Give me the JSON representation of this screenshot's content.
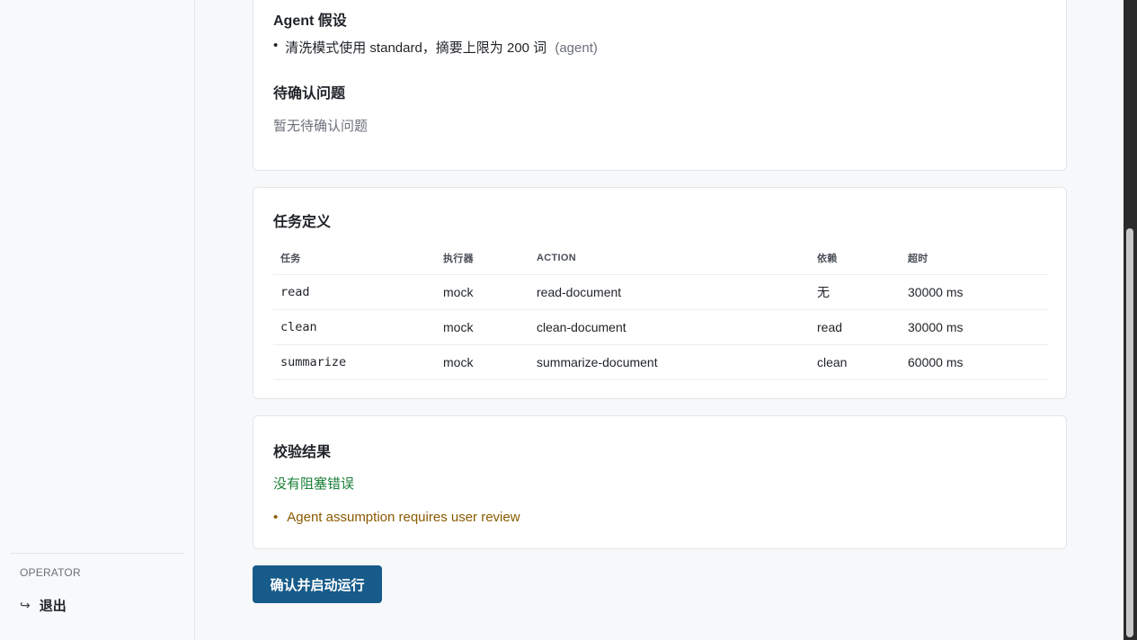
{
  "sidebar": {
    "role_label": "OPERATOR",
    "logout_icon": "↪",
    "logout_label": "退出"
  },
  "assumptions": {
    "title": "Agent 假设",
    "items": [
      {
        "text": "清洗模式使用 standard，摘要上限为 200 词",
        "source": "(agent)"
      }
    ]
  },
  "pending": {
    "title": "待确认问题",
    "empty_text": "暂无待确认问题"
  },
  "tasks": {
    "title": "任务定义",
    "columns": [
      "任务",
      "执行器",
      "ACTION",
      "依赖",
      "超时"
    ],
    "rows": [
      [
        "read",
        "mock",
        "read-document",
        "无",
        "30000 ms"
      ],
      [
        "clean",
        "mock",
        "clean-document",
        "read",
        "30000 ms"
      ],
      [
        "summarize",
        "mock",
        "summarize-document",
        "clean",
        "60000 ms"
      ]
    ]
  },
  "validation": {
    "title": "校验结果",
    "ok_text": "没有阻塞错误",
    "warnings": [
      "Agent assumption requires user review"
    ],
    "ok_color": "#1a7f37",
    "warn_color": "#8a5a00"
  },
  "actions": {
    "confirm_label": "确认并启动运行",
    "accent_color": "#175b8a"
  }
}
